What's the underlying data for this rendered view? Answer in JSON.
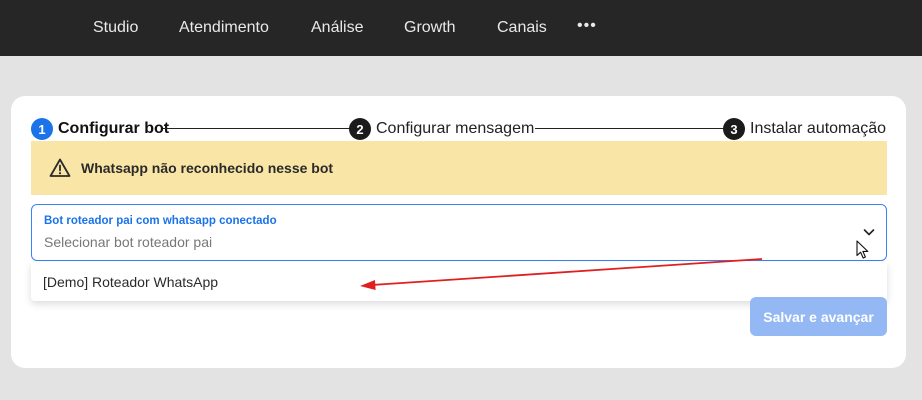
{
  "nav": {
    "items": [
      {
        "label": "Studio"
      },
      {
        "label": "Atendimento"
      },
      {
        "label": "Análise"
      },
      {
        "label": "Growth"
      },
      {
        "label": "Canais"
      }
    ],
    "more_label": "•••"
  },
  "steps": [
    {
      "number": "1",
      "label": "Configurar bot",
      "state": "active"
    },
    {
      "number": "2",
      "label": "Configurar mensagem",
      "state": "pending"
    },
    {
      "number": "3",
      "label": "Instalar automação",
      "state": "pending"
    }
  ],
  "alert": {
    "icon": "warning-icon",
    "text": "Whatsapp não reconhecido nesse bot"
  },
  "select": {
    "label": "Bot roteador pai com whatsapp conectado",
    "placeholder": "Selecionar bot roteador pai",
    "options": [
      {
        "label": "[Demo] Roteador WhatsApp"
      }
    ]
  },
  "actions": {
    "save_label": "Salvar e avançar"
  },
  "colors": {
    "accent": "#1a73e8",
    "topbar": "#262626",
    "alert_bg": "#f9e6a6",
    "button_disabled": "#93b8f4",
    "annotation_arrow": "#e02020"
  }
}
